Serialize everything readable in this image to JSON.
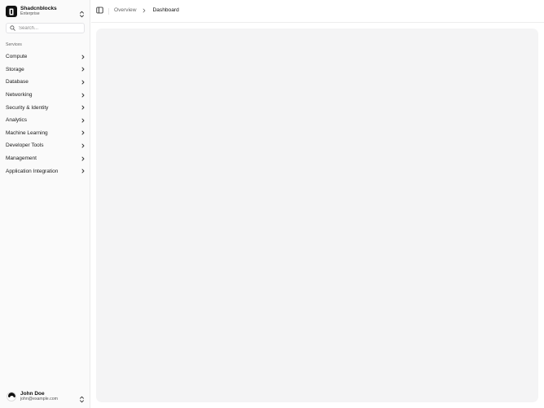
{
  "team": {
    "name": "Shadcnblocks",
    "plan": "Enterprise",
    "logo_icon": "shadcnblocks-logo-icon",
    "switch_icon": "chevrons-up-down-icon"
  },
  "search": {
    "placeholder": "Search...",
    "value": ""
  },
  "sidebar": {
    "group_label": "Services",
    "items": [
      {
        "label": "Compute"
      },
      {
        "label": "Storage"
      },
      {
        "label": "Database"
      },
      {
        "label": "Networking"
      },
      {
        "label": "Security & Identity"
      },
      {
        "label": "Analytics"
      },
      {
        "label": "Machine Learning"
      },
      {
        "label": "Developer Tools"
      },
      {
        "label": "Management"
      },
      {
        "label": "Application Integration"
      }
    ]
  },
  "user": {
    "name": "John Doe",
    "email": "john@example.com"
  },
  "header": {
    "toggle_icon": "panel-left-icon",
    "breadcrumb": {
      "parent": "Overview",
      "current": "Dashboard"
    }
  },
  "colors": {
    "sidebar_bg": "#fafafa",
    "content_bg": "#f4f4f5",
    "logo_bg": "#111111"
  }
}
